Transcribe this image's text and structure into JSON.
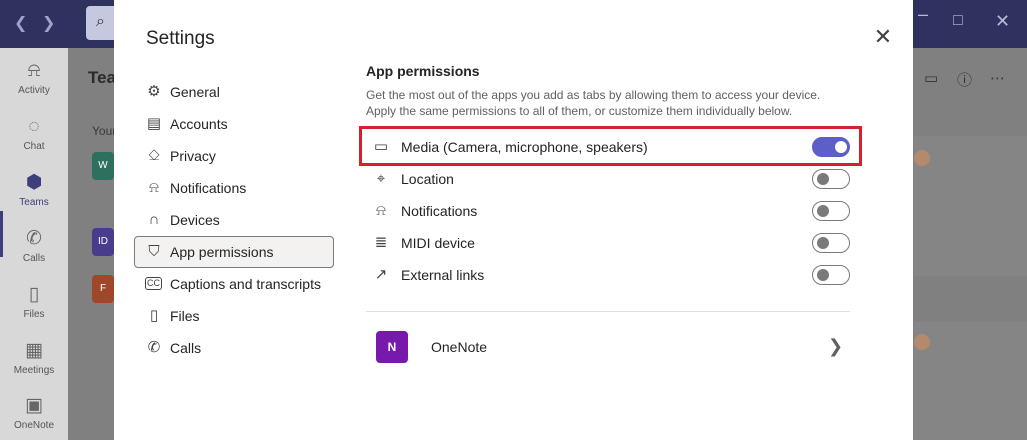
{
  "background": {
    "search_icon": "search-icon",
    "rail": [
      {
        "label": "Activity",
        "icon": "bell-icon"
      },
      {
        "label": "Chat",
        "icon": "chat-icon"
      },
      {
        "label": "Teams",
        "icon": "teams-icon"
      },
      {
        "label": "Calls",
        "icon": "phone-icon"
      },
      {
        "label": "Files",
        "icon": "file-icon"
      },
      {
        "label": "Meetings",
        "icon": "calendar-icon"
      },
      {
        "label": "OneNote",
        "icon": "onenote-icon"
      }
    ],
    "heading": "Tea",
    "subtext": "Your",
    "cards": [
      "W",
      "ID",
      "F"
    ],
    "colors": {
      "titlebar": "#2f315e",
      "accent": "#5b5fc7",
      "highlight": "#d4212b"
    }
  },
  "dialog": {
    "title": "Settings",
    "close_icon": "close-icon",
    "nav": [
      {
        "label": "General",
        "icon": "gear-icon"
      },
      {
        "label": "Accounts",
        "icon": "id-card-icon"
      },
      {
        "label": "Privacy",
        "icon": "lock-icon"
      },
      {
        "label": "Notifications",
        "icon": "bell-icon"
      },
      {
        "label": "Devices",
        "icon": "headset-icon"
      },
      {
        "label": "App permissions",
        "icon": "shield-icon",
        "selected": true
      },
      {
        "label": "Captions and transcripts",
        "icon": "captions-icon"
      },
      {
        "label": "Files",
        "icon": "file-icon"
      },
      {
        "label": "Calls",
        "icon": "phone-icon"
      }
    ],
    "section": {
      "title": "App permissions",
      "description": "Get the most out of the apps you add as tabs by allowing them to access your device. Apply the same permissions to all of them, or customize them individually below."
    },
    "permissions": [
      {
        "label": "Media (Camera, microphone, speakers)",
        "icon": "video-camera-icon",
        "enabled": true
      },
      {
        "label": "Location",
        "icon": "location-pin-icon",
        "enabled": false
      },
      {
        "label": "Notifications",
        "icon": "bell-icon",
        "enabled": false
      },
      {
        "label": "MIDI device",
        "icon": "piano-keyboard-icon",
        "enabled": false
      },
      {
        "label": "External links",
        "icon": "external-link-icon",
        "enabled": false
      }
    ],
    "apps": [
      {
        "label": "OneNote",
        "tile_text": "N",
        "icon": "onenote-icon"
      }
    ]
  }
}
